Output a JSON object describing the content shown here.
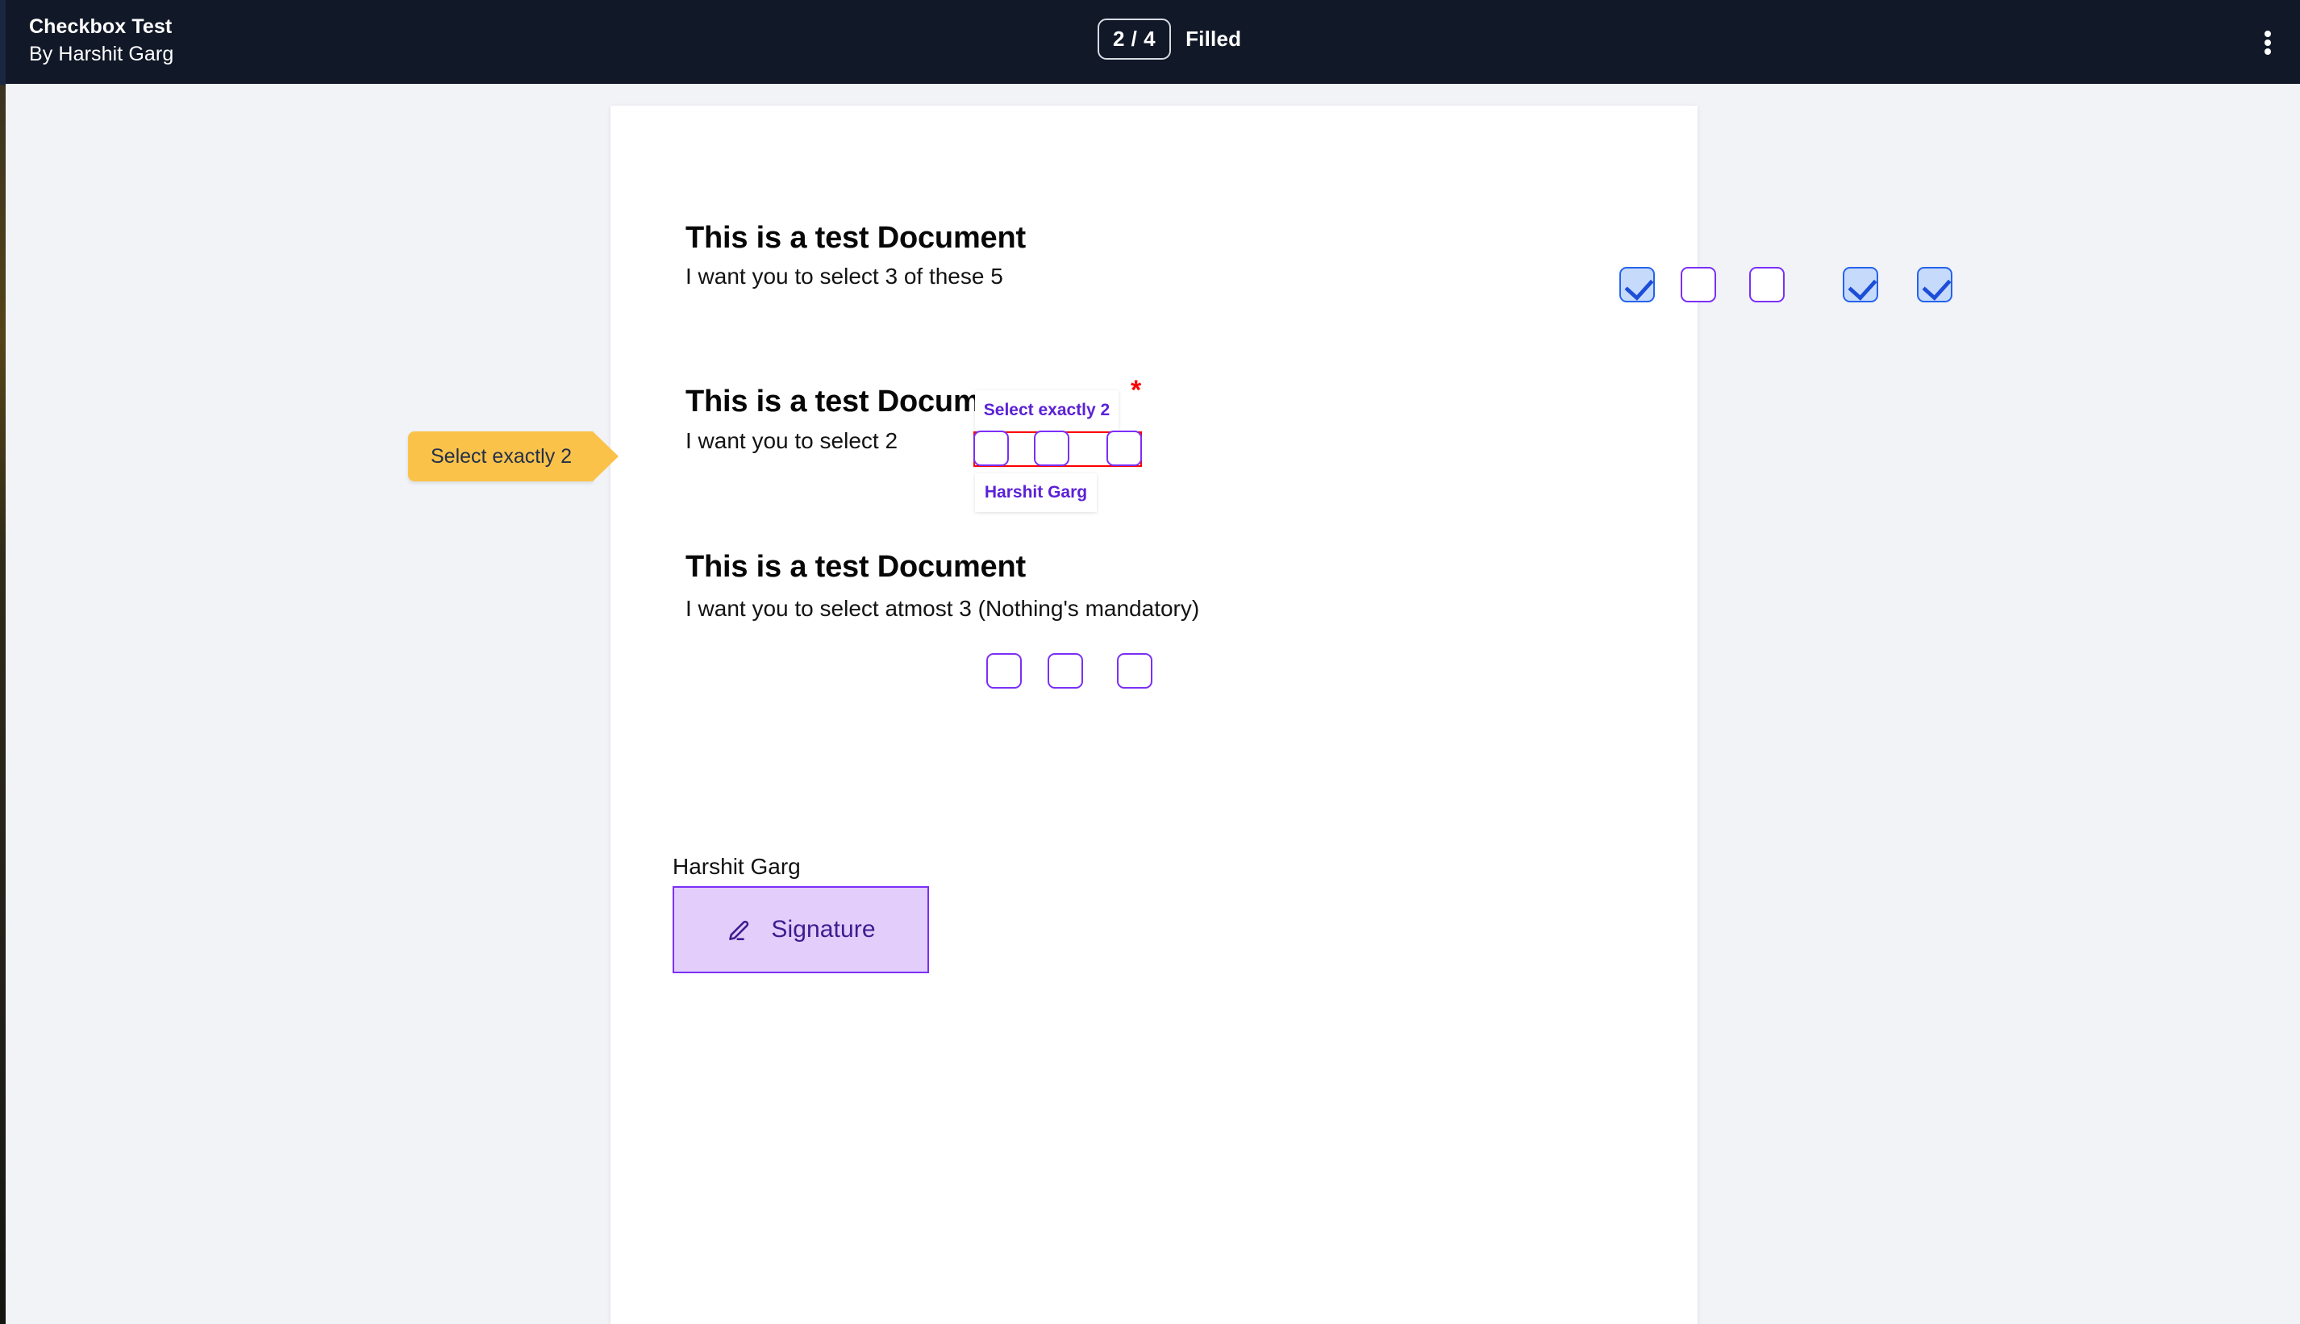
{
  "window": {
    "background_color": "#f1f3f7",
    "page_color": "#ffffff"
  },
  "header": {
    "background_color": "#111827",
    "title": "Checkbox Test",
    "subtitle": "By Harshit Garg",
    "progress_count": "2 / 4",
    "progress_label": "Filled",
    "menu_icon": "kebab-menu-icon"
  },
  "callout": {
    "text": "Select exactly 2",
    "background_color": "#fbc24a",
    "text_color": "#243049"
  },
  "document": {
    "sections": [
      {
        "heading": "This is a test Document",
        "prompt": "I want you to select 3 of these 5",
        "checkboxes": [
          {
            "checked": true
          },
          {
            "checked": false
          },
          {
            "checked": false
          },
          {
            "checked": true
          },
          {
            "checked": true
          }
        ]
      },
      {
        "heading": "This is a test Document",
        "prompt": "I want you to select 2",
        "required": true,
        "required_marker": "*",
        "group_tooltip": "Select exactly 2",
        "group_owner": "Harshit Garg",
        "checkboxes": [
          {
            "checked": false
          },
          {
            "checked": false
          },
          {
            "checked": false
          }
        ]
      },
      {
        "heading": "This is a test Document",
        "prompt": "I want you to select atmost 3 (Nothing's mandatory)",
        "checkboxes": [
          {
            "checked": false
          },
          {
            "checked": false
          },
          {
            "checked": false
          }
        ]
      }
    ],
    "signature_field": {
      "signer_name": "Harshit Garg",
      "label": "Signature",
      "icon": "signature-pen-icon",
      "fill_color": "#e2cdfb",
      "border_color": "#7b2ff7"
    }
  },
  "colors": {
    "checkbox_unchecked_border": "#7b2ff7",
    "checkbox_checked_border": "#2563eb",
    "checkbox_checked_fill": "#c6dafc",
    "checkbox_check_mark": "#1d4ed8",
    "required_outline": "#fe0000",
    "tooltip_text": "#5b21d6"
  }
}
